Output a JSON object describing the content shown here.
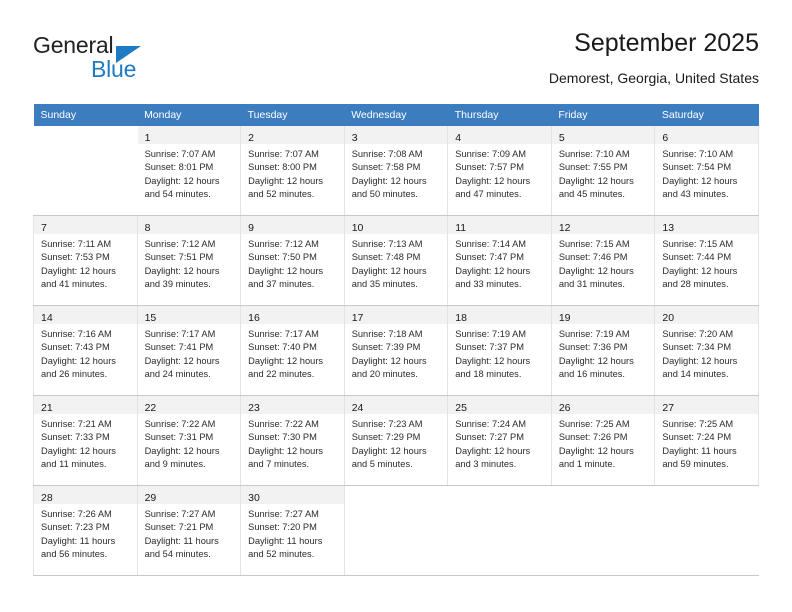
{
  "brand": {
    "line1": "General",
    "line2": "Blue",
    "triangle_color": "#1f7ac4"
  },
  "header": {
    "title": "September 2025",
    "subtitle": "Demorest, Georgia, United States",
    "accent_color": "#3c7dc0"
  },
  "calendar": {
    "weekday_headers": [
      "Sunday",
      "Monday",
      "Tuesday",
      "Wednesday",
      "Thursday",
      "Friday",
      "Saturday"
    ],
    "weeks": [
      [
        {
          "day": "",
          "lines": []
        },
        {
          "day": "1",
          "lines": [
            "Sunrise: 7:07 AM",
            "Sunset: 8:01 PM",
            "Daylight: 12 hours",
            "and 54 minutes."
          ]
        },
        {
          "day": "2",
          "lines": [
            "Sunrise: 7:07 AM",
            "Sunset: 8:00 PM",
            "Daylight: 12 hours",
            "and 52 minutes."
          ]
        },
        {
          "day": "3",
          "lines": [
            "Sunrise: 7:08 AM",
            "Sunset: 7:58 PM",
            "Daylight: 12 hours",
            "and 50 minutes."
          ]
        },
        {
          "day": "4",
          "lines": [
            "Sunrise: 7:09 AM",
            "Sunset: 7:57 PM",
            "Daylight: 12 hours",
            "and 47 minutes."
          ]
        },
        {
          "day": "5",
          "lines": [
            "Sunrise: 7:10 AM",
            "Sunset: 7:55 PM",
            "Daylight: 12 hours",
            "and 45 minutes."
          ]
        },
        {
          "day": "6",
          "lines": [
            "Sunrise: 7:10 AM",
            "Sunset: 7:54 PM",
            "Daylight: 12 hours",
            "and 43 minutes."
          ]
        }
      ],
      [
        {
          "day": "7",
          "lines": [
            "Sunrise: 7:11 AM",
            "Sunset: 7:53 PM",
            "Daylight: 12 hours",
            "and 41 minutes."
          ]
        },
        {
          "day": "8",
          "lines": [
            "Sunrise: 7:12 AM",
            "Sunset: 7:51 PM",
            "Daylight: 12 hours",
            "and 39 minutes."
          ]
        },
        {
          "day": "9",
          "lines": [
            "Sunrise: 7:12 AM",
            "Sunset: 7:50 PM",
            "Daylight: 12 hours",
            "and 37 minutes."
          ]
        },
        {
          "day": "10",
          "lines": [
            "Sunrise: 7:13 AM",
            "Sunset: 7:48 PM",
            "Daylight: 12 hours",
            "and 35 minutes."
          ]
        },
        {
          "day": "11",
          "lines": [
            "Sunrise: 7:14 AM",
            "Sunset: 7:47 PM",
            "Daylight: 12 hours",
            "and 33 minutes."
          ]
        },
        {
          "day": "12",
          "lines": [
            "Sunrise: 7:15 AM",
            "Sunset: 7:46 PM",
            "Daylight: 12 hours",
            "and 31 minutes."
          ]
        },
        {
          "day": "13",
          "lines": [
            "Sunrise: 7:15 AM",
            "Sunset: 7:44 PM",
            "Daylight: 12 hours",
            "and 28 minutes."
          ]
        }
      ],
      [
        {
          "day": "14",
          "lines": [
            "Sunrise: 7:16 AM",
            "Sunset: 7:43 PM",
            "Daylight: 12 hours",
            "and 26 minutes."
          ]
        },
        {
          "day": "15",
          "lines": [
            "Sunrise: 7:17 AM",
            "Sunset: 7:41 PM",
            "Daylight: 12 hours",
            "and 24 minutes."
          ]
        },
        {
          "day": "16",
          "lines": [
            "Sunrise: 7:17 AM",
            "Sunset: 7:40 PM",
            "Daylight: 12 hours",
            "and 22 minutes."
          ]
        },
        {
          "day": "17",
          "lines": [
            "Sunrise: 7:18 AM",
            "Sunset: 7:39 PM",
            "Daylight: 12 hours",
            "and 20 minutes."
          ]
        },
        {
          "day": "18",
          "lines": [
            "Sunrise: 7:19 AM",
            "Sunset: 7:37 PM",
            "Daylight: 12 hours",
            "and 18 minutes."
          ]
        },
        {
          "day": "19",
          "lines": [
            "Sunrise: 7:19 AM",
            "Sunset: 7:36 PM",
            "Daylight: 12 hours",
            "and 16 minutes."
          ]
        },
        {
          "day": "20",
          "lines": [
            "Sunrise: 7:20 AM",
            "Sunset: 7:34 PM",
            "Daylight: 12 hours",
            "and 14 minutes."
          ]
        }
      ],
      [
        {
          "day": "21",
          "lines": [
            "Sunrise: 7:21 AM",
            "Sunset: 7:33 PM",
            "Daylight: 12 hours",
            "and 11 minutes."
          ]
        },
        {
          "day": "22",
          "lines": [
            "Sunrise: 7:22 AM",
            "Sunset: 7:31 PM",
            "Daylight: 12 hours",
            "and 9 minutes."
          ]
        },
        {
          "day": "23",
          "lines": [
            "Sunrise: 7:22 AM",
            "Sunset: 7:30 PM",
            "Daylight: 12 hours",
            "and 7 minutes."
          ]
        },
        {
          "day": "24",
          "lines": [
            "Sunrise: 7:23 AM",
            "Sunset: 7:29 PM",
            "Daylight: 12 hours",
            "and 5 minutes."
          ]
        },
        {
          "day": "25",
          "lines": [
            "Sunrise: 7:24 AM",
            "Sunset: 7:27 PM",
            "Daylight: 12 hours",
            "and 3 minutes."
          ]
        },
        {
          "day": "26",
          "lines": [
            "Sunrise: 7:25 AM",
            "Sunset: 7:26 PM",
            "Daylight: 12 hours",
            "and 1 minute."
          ]
        },
        {
          "day": "27",
          "lines": [
            "Sunrise: 7:25 AM",
            "Sunset: 7:24 PM",
            "Daylight: 11 hours",
            "and 59 minutes."
          ]
        }
      ],
      [
        {
          "day": "28",
          "lines": [
            "Sunrise: 7:26 AM",
            "Sunset: 7:23 PM",
            "Daylight: 11 hours",
            "and 56 minutes."
          ]
        },
        {
          "day": "29",
          "lines": [
            "Sunrise: 7:27 AM",
            "Sunset: 7:21 PM",
            "Daylight: 11 hours",
            "and 54 minutes."
          ]
        },
        {
          "day": "30",
          "lines": [
            "Sunrise: 7:27 AM",
            "Sunset: 7:20 PM",
            "Daylight: 11 hours",
            "and 52 minutes."
          ]
        },
        {
          "day": "",
          "lines": []
        },
        {
          "day": "",
          "lines": []
        },
        {
          "day": "",
          "lines": []
        },
        {
          "day": "",
          "lines": []
        }
      ]
    ]
  }
}
